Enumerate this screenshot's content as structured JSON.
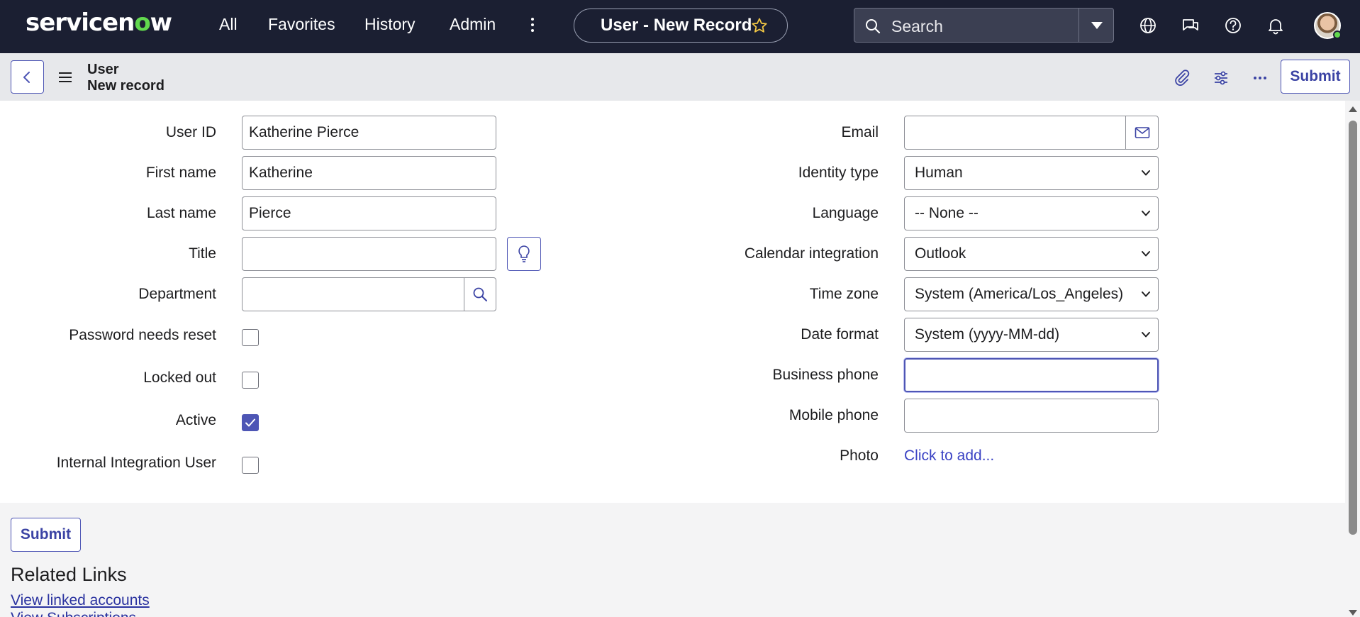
{
  "topnav": {
    "logo": {
      "pre": "servicen",
      "o": "o",
      "post": "w"
    },
    "items": [
      "All",
      "Favorites",
      "History",
      "Admin"
    ],
    "record_title": "User - New Record",
    "search_label": "Search",
    "icons": [
      "globe-icon",
      "chat-icon",
      "help-icon",
      "bell-icon"
    ]
  },
  "subheader": {
    "table": "User",
    "record": "New record",
    "submit_label": "Submit"
  },
  "form": {
    "left": {
      "user_id": {
        "label": "User ID",
        "value": "Katherine Pierce"
      },
      "first_name": {
        "label": "First name",
        "value": "Katherine"
      },
      "last_name": {
        "label": "Last name",
        "value": "Pierce"
      },
      "title": {
        "label": "Title",
        "value": ""
      },
      "department": {
        "label": "Department",
        "value": ""
      },
      "password_needs_reset": {
        "label": "Password needs reset",
        "checked": false
      },
      "locked_out": {
        "label": "Locked out",
        "checked": false
      },
      "active": {
        "label": "Active",
        "checked": true
      },
      "internal_integration_user": {
        "label": "Internal Integration User",
        "checked": false
      }
    },
    "right": {
      "email": {
        "label": "Email",
        "value": ""
      },
      "identity_type": {
        "label": "Identity type",
        "value": "Human"
      },
      "language": {
        "label": "Language",
        "value": "-- None --"
      },
      "calendar_integration": {
        "label": "Calendar integration",
        "value": "Outlook"
      },
      "time_zone": {
        "label": "Time zone",
        "value": "System (America/Los_Angeles)"
      },
      "date_format": {
        "label": "Date format",
        "value": "System (yyyy-MM-dd)"
      },
      "business_phone": {
        "label": "Business phone",
        "value": ""
      },
      "mobile_phone": {
        "label": "Mobile phone",
        "value": ""
      },
      "photo": {
        "label": "Photo",
        "link": "Click to add..."
      }
    }
  },
  "footer": {
    "submit_label": "Submit",
    "related_links_title": "Related Links",
    "related_links": [
      "View linked accounts",
      "View Subscriptions"
    ]
  },
  "colors": {
    "nav_bg": "#1b1f32",
    "accent": "#4e56b5",
    "logo_green": "#62d84e"
  }
}
